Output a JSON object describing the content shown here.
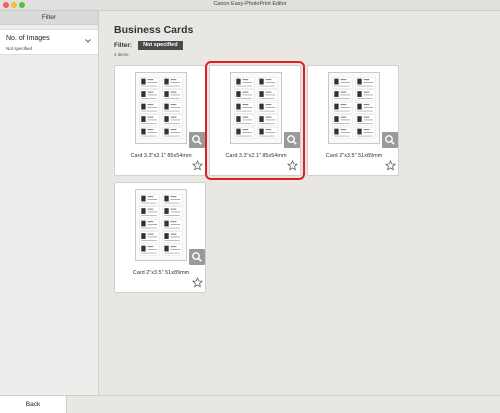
{
  "window": {
    "title": "Canon Easy-PhotoPrint Editor"
  },
  "sidebar": {
    "header": "Filter",
    "filters": [
      {
        "label": "No. of Images",
        "value": "Not specified"
      }
    ]
  },
  "main": {
    "title": "Business Cards",
    "filter_label": "Filter:",
    "filter_chip": "Not specified",
    "count": "4 items",
    "cards": [
      {
        "label": "Card 3.3\"x2.1\" 85x54mm",
        "selected": false
      },
      {
        "label": "Card 3.3\"x2.1\" 85x54mm",
        "selected": true
      },
      {
        "label": "Card 2\"x3.5\" 51x89mm",
        "selected": false
      },
      {
        "label": "Card 2\"x3.5\" 51x89mm",
        "selected": false
      }
    ]
  },
  "footer": {
    "back_label": "Back"
  },
  "colors": {
    "selection": "#e02020",
    "chip_bg": "#4a4a4a"
  },
  "icons": {
    "zoom": "magnifier-icon",
    "favorite": "star-outline-icon",
    "expand": "chevron-down-icon"
  }
}
